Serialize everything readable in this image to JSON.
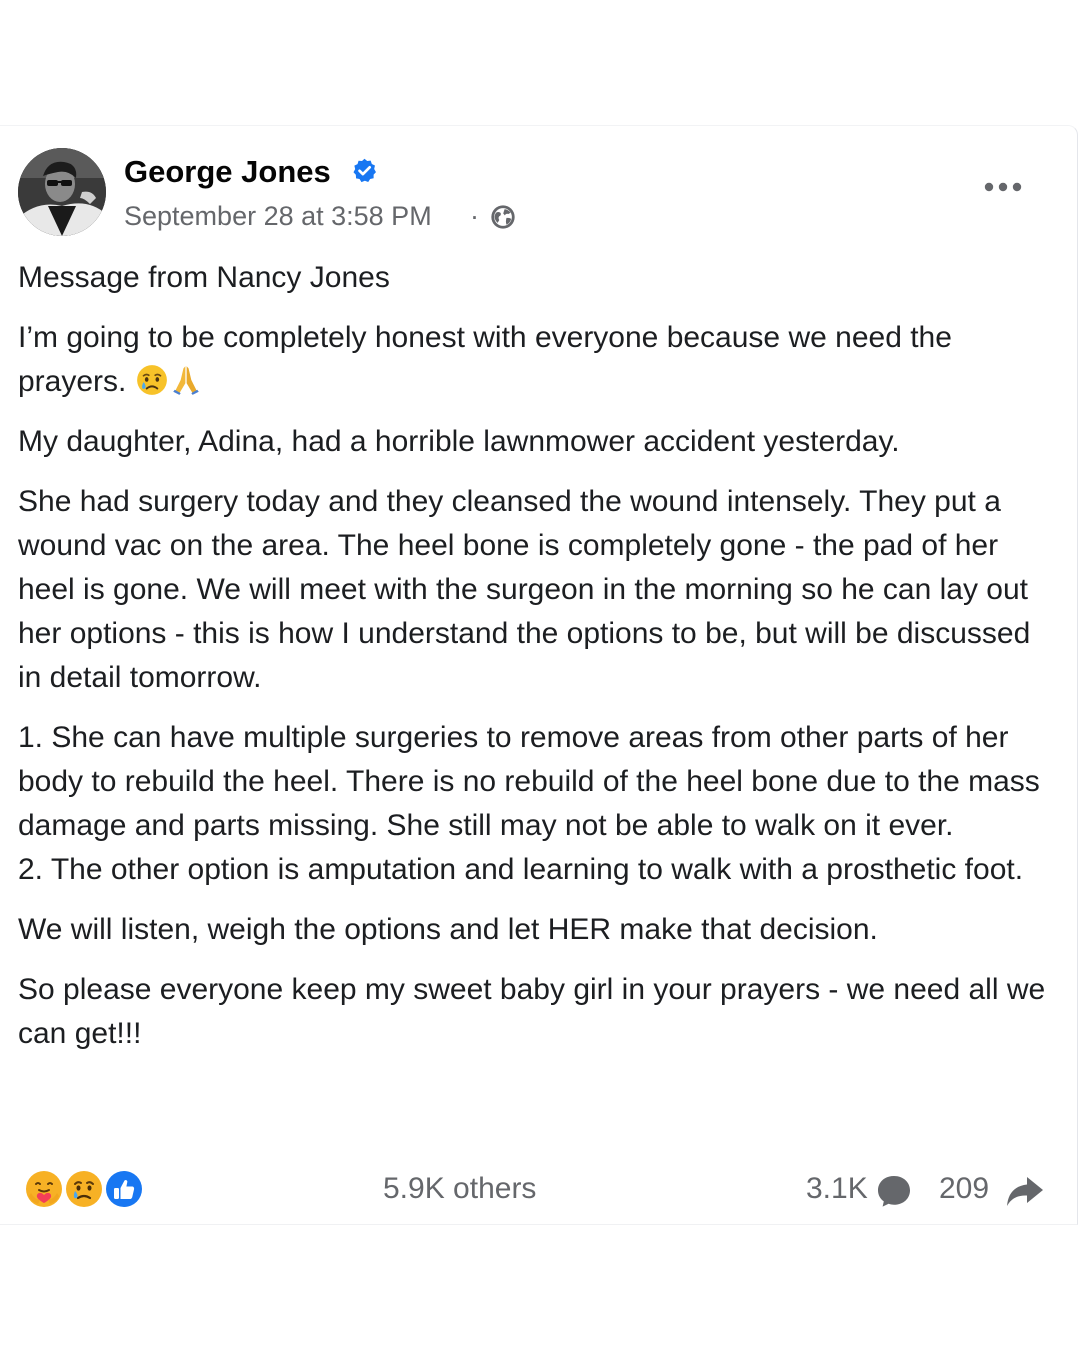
{
  "post": {
    "author": "George Jones",
    "verified": true,
    "timestamp": "September 28 at 3:58 PM",
    "separator": "·",
    "audience_icon": "globe-icon",
    "menu_icon": "more-options-icon",
    "body": {
      "p1": "Message from Nancy Jones",
      "p2": "I’m going to be completely honest with everyone because we need the prayers.",
      "p2_emojis": [
        "crying-face-emoji",
        "folded-hands-emoji"
      ],
      "p3": "My daughter, Adina, had a horrible lawnmower accident yesterday.",
      "p4": "She had surgery today and they cleansed the wound intensely. They put a wound vac on the area. The heel bone is completely gone - the pad of her heel is gone. We will meet with the surgeon in the morning so he can lay out her options - this is how I understand the options to be, but will be discussed in detail tomorrow.",
      "p5": "1. She can have multiple surgeries to remove areas from other parts of her body to rebuild the heel. There is no rebuild of the heel bone due to the mass damage and parts missing. She still may not be able to walk on it ever.\n2. The other option is amputation and learning to walk with a prosthetic foot.",
      "p6": "We will listen, weigh the options   and let HER make that decision.",
      "p7": "So please everyone keep my sweet baby girl in your prayers - we need all we can get!!!"
    }
  },
  "footer": {
    "reactions": [
      "care-reaction-icon",
      "sad-reaction-icon",
      "like-reaction-icon"
    ],
    "reaction_count": "5.9K others",
    "comment_count": "3.1K",
    "share_count": "209"
  },
  "colors": {
    "text": "#1c1e21",
    "secondary_text": "#65676b",
    "verified_blue": "#1877f2",
    "like_blue": "#1877f2",
    "reaction_yellow": "#f7b125"
  }
}
